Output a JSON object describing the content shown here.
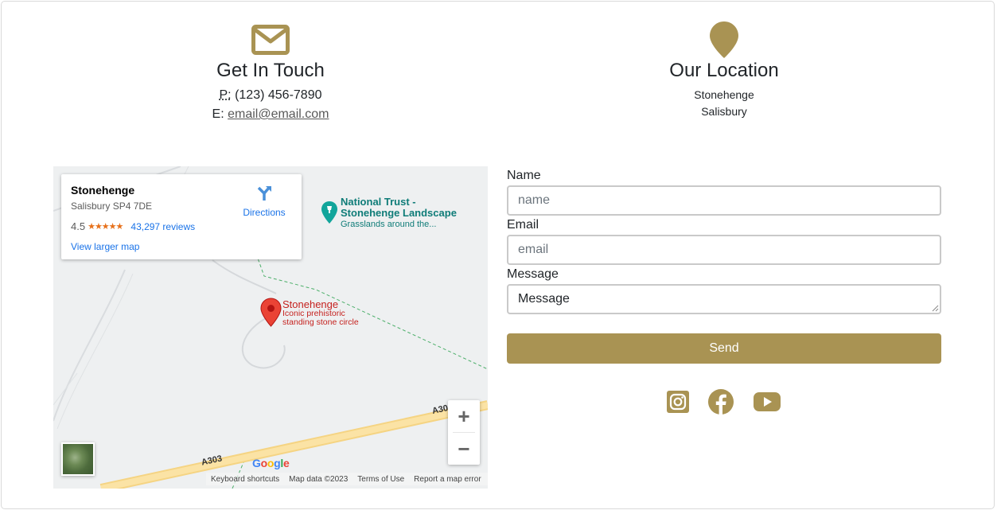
{
  "contact": {
    "title": "Get In Touch",
    "phone_prefix": "P:",
    "phone": "(123) 456-7890",
    "email_prefix": "E:",
    "email": "email@email.com"
  },
  "location": {
    "title": "Our Location",
    "line1": "Stonehenge",
    "line2": "Salisbury"
  },
  "map": {
    "card": {
      "name": "Stonehenge",
      "address": "Salisbury SP4 7DE",
      "rating": "4.5",
      "stars": "★★★★★",
      "reviews": "43,297 reviews",
      "directions": "Directions",
      "larger_map": "View larger map"
    },
    "national_trust": {
      "line1": "National Trust -",
      "line2": "Stonehenge Landscape",
      "sub": "Grasslands around the..."
    },
    "stonehenge_marker": {
      "title": "Stonehenge",
      "sub1": "Iconic prehistoric",
      "sub2": "standing stone circle"
    },
    "roads": {
      "a303_left": "A303",
      "a303_right": "A30"
    },
    "zoom_in": "+",
    "zoom_out": "−",
    "google": [
      "G",
      "o",
      "o",
      "g",
      "l",
      "e"
    ],
    "google_colors": [
      "#4285f4",
      "#ea4335",
      "#fbbc05",
      "#4285f4",
      "#34a853",
      "#ea4335"
    ],
    "attribution": {
      "shortcuts": "Keyboard shortcuts",
      "data": "Map data ©2023",
      "terms": "Terms of Use",
      "report": "Report a map error"
    }
  },
  "form": {
    "name_label": "Name",
    "name_placeholder": "name",
    "email_label": "Email",
    "email_placeholder": "email",
    "message_label": "Message",
    "message_value": "Message",
    "send": "Send"
  },
  "social": {
    "icons": [
      "instagram-icon",
      "facebook-icon",
      "youtube-icon"
    ]
  },
  "colors": {
    "accent": "#a99353",
    "link_blue": "#1a73e8",
    "marker_red": "#c5221f",
    "trust_teal": "#0f7c78"
  }
}
